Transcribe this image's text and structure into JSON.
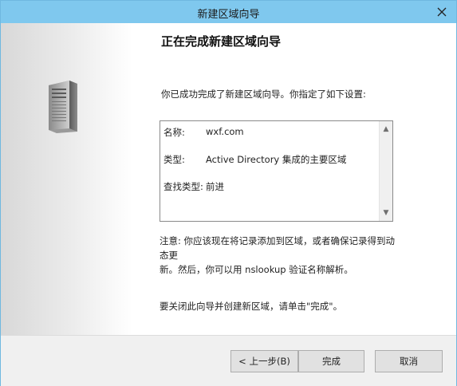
{
  "window": {
    "title": "新建区域向导",
    "close_icon": "close-icon"
  },
  "sidebar": {
    "icon": "server-icon"
  },
  "wizard": {
    "heading": "正在完成新建区域向导",
    "intro": "你已成功完成了新建区域向导。你指定了如下设置:",
    "summary": {
      "name_label": "名称:",
      "name_value": "wxf.com",
      "type_label": "类型:",
      "type_value": "Active Directory 集成的主要区域",
      "lookup_label": "查找类型:",
      "lookup_value": "前进"
    },
    "note_line1": "注意: 你应该现在将记录添加到区域，或者确保记录得到动态更",
    "note_line2": "新。然后，你可以用 nslookup 验证名称解析。",
    "close_instruction": "要关闭此向导并创建新区域，请单击\"完成\"。"
  },
  "buttons": {
    "back": "< 上一步(B)",
    "finish": "完成",
    "cancel": "取消"
  },
  "colors": {
    "titlebar": "#7fc8ee",
    "close_hover": "#e81123"
  }
}
